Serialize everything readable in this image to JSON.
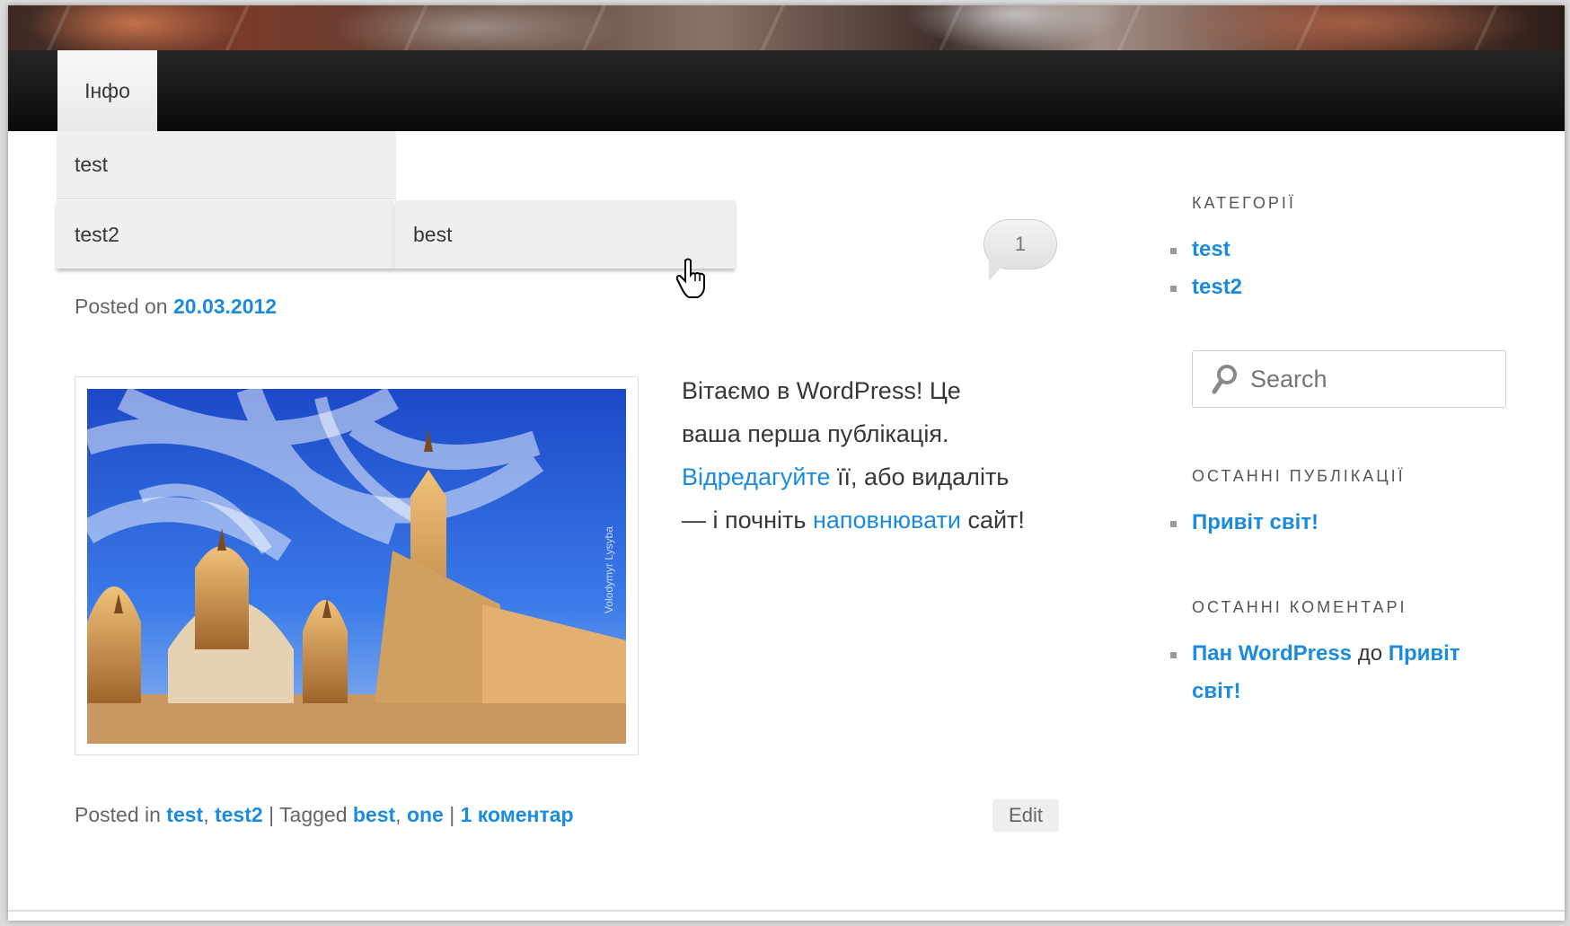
{
  "nav": {
    "items": [
      {
        "label": "Інфо"
      }
    ],
    "dropdown": {
      "test": "test",
      "test2": "test2",
      "best": "best"
    }
  },
  "post": {
    "comment_count": "1",
    "posted_on_prefix": "Posted on",
    "date": "20.03.2012",
    "body": {
      "line1": "Вітаємо в WordPress! Це",
      "line2": "ваша перша публікація.",
      "edit_link": "Відредагуйте",
      "line3_rest": " її, або видаліть",
      "line4_start": "— і почніть ",
      "fill_link": "наповнювати",
      "line4_end": " сайт!"
    },
    "meta": {
      "posted_in": "Posted in ",
      "cat1": "test",
      "comma1": ", ",
      "cat2": "test2",
      "tagged": " | Tagged ",
      "tag1": "best",
      "comma2": ", ",
      "tag2": "one",
      "sep": " | ",
      "comments": "1 коментар"
    },
    "edit_label": "Edit",
    "image_watermark": "Volodymyr Lysyba"
  },
  "sidebar": {
    "categories_title": "КАТЕГОРІЇ",
    "categories": [
      "test",
      "test2"
    ],
    "search_placeholder": "Search",
    "recent_posts_title": "ОСТАННІ ПУБЛІКАЦІЇ",
    "recent_posts": [
      "Привіт світ!"
    ],
    "recent_comments_title": "ОСТАННІ КОМЕНТАРІ",
    "recent_comment": {
      "author": "Пан WordPress",
      "on": " до ",
      "post_line1": "Привіт",
      "post_line2": "світ!"
    }
  },
  "colors": {
    "link": "#1b8be0",
    "navbar": "#111111",
    "text": "#373737"
  }
}
